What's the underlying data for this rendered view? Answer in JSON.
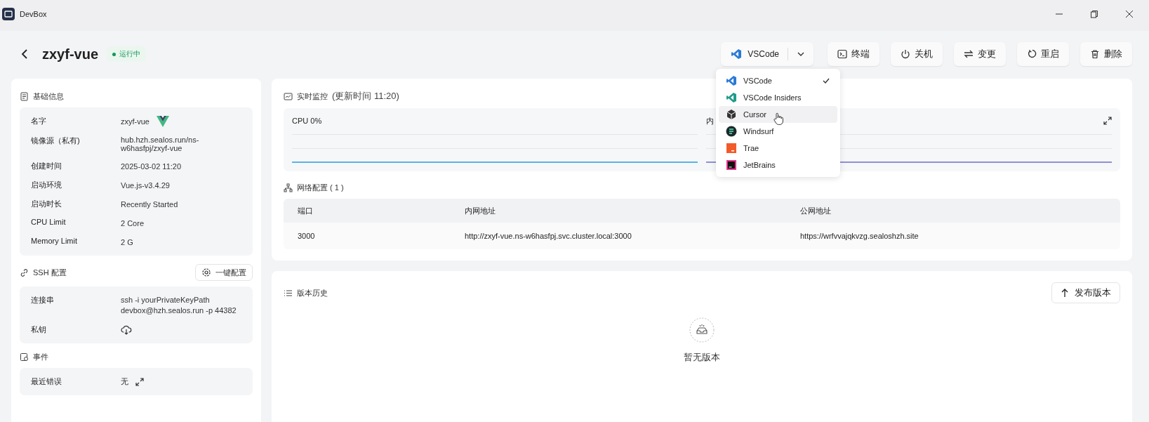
{
  "window": {
    "title": "DevBox"
  },
  "header": {
    "name": "zxyf-vue",
    "status": "运行中"
  },
  "actions": {
    "ide": "VSCode",
    "buttons": [
      {
        "kind": "terminal",
        "label": "终端"
      },
      {
        "kind": "power",
        "label": "关机"
      },
      {
        "kind": "swap",
        "label": "变更"
      },
      {
        "kind": "restart",
        "label": "重启"
      },
      {
        "kind": "delete",
        "label": "删除"
      }
    ]
  },
  "ide_menu": [
    {
      "kind": "vscode",
      "label": "VSCode",
      "selected": true,
      "hovered": false
    },
    {
      "kind": "insiders",
      "label": "VSCode Insiders",
      "selected": false,
      "hovered": false
    },
    {
      "kind": "cursor",
      "label": "Cursor",
      "selected": false,
      "hovered": true
    },
    {
      "kind": "windsurf",
      "label": "Windsurf",
      "selected": false,
      "hovered": false
    },
    {
      "kind": "trae",
      "label": "Trae",
      "selected": false,
      "hovered": false
    },
    {
      "kind": "jetbrains",
      "label": "JetBrains",
      "selected": false,
      "hovered": false
    }
  ],
  "basic_info": {
    "title": "基础信息",
    "rows": [
      {
        "label": "名字",
        "value": "zxyf-vue",
        "kind": "vue"
      },
      {
        "label": "镜像源（私有)",
        "value": "hub.hzh.sealos.run/ns-w6hasfpj/zxyf-vue"
      },
      {
        "label": "创建时间",
        "value": "2025-03-02 11:20"
      },
      {
        "label": "启动环境",
        "value": "Vue.js-v3.4.29"
      },
      {
        "label": "启动时长",
        "value": "Recently Started"
      },
      {
        "label": "CPU Limit",
        "value": "2 Core"
      },
      {
        "label": "Memory Limit",
        "value": "2 G"
      }
    ]
  },
  "ssh": {
    "title": "SSH 配置",
    "button": "一键配置",
    "rows": [
      {
        "label": "连接串",
        "value": "ssh -i yourPrivateKeyPath devbox@hzh.sealos.run -p 44382"
      },
      {
        "label": "私钥",
        "kind": "download"
      }
    ]
  },
  "events": {
    "title": "事件",
    "rows": [
      {
        "label": "最近错误",
        "value": "无",
        "kind": "expand"
      }
    ]
  },
  "monitor": {
    "title": "实时监控",
    "updated": "(更新时间  11:20)",
    "charts": [
      {
        "label": "CPU 0%",
        "color": "#5ab4e6"
      },
      {
        "label": "内",
        "color": "#8f8fd6"
      }
    ]
  },
  "network": {
    "title": "网络配置 ( 1 )",
    "columns": [
      "端口",
      "内网地址",
      "公网地址"
    ],
    "rows": [
      [
        "3000",
        "http://zxyf-vue.ns-w6hasfpj.svc.cluster.local:3000",
        "https://wrfvvajqkvzg.sealoshzh.site"
      ]
    ]
  },
  "history": {
    "title": "版本历史",
    "button": "发布版本",
    "empty": "暂无版本"
  }
}
